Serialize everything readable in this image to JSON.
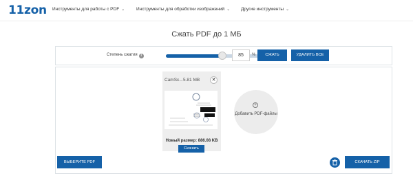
{
  "header": {
    "logo": "11zon",
    "nav": [
      {
        "label": "Инструменты для работы с PDF"
      },
      {
        "label": "Инструменты для обработки изображений"
      },
      {
        "label": "Другие инструменты"
      }
    ]
  },
  "page_title": "Сжать PDF до 1 МБ",
  "settings": {
    "compression_label": "Степень сжатия",
    "compression_value": "85",
    "compression_level": 0.85,
    "percent_sign": "%",
    "compress_button": "СЖАТЬ",
    "delete_all_button": "УДАЛИТЬ ВСЕ"
  },
  "file_card": {
    "name": "CamSc...",
    "size": "5.81 MB",
    "new_size": "Новый размер: 886.08 KB",
    "download_button": "Скачать"
  },
  "add_files_label": "Добавить PDF-файлы",
  "footer": {
    "select_button": "ВЫБЕРИТЕ PDF",
    "download_zip_button": "СКАЧАТЬ ZIP"
  },
  "colors": {
    "accent": "#1561a8",
    "card_bg": "#eeeeee"
  },
  "icons": [
    "info-icon",
    "chevron-down-icon",
    "close-icon",
    "plus-icon",
    "trash-icon"
  ]
}
